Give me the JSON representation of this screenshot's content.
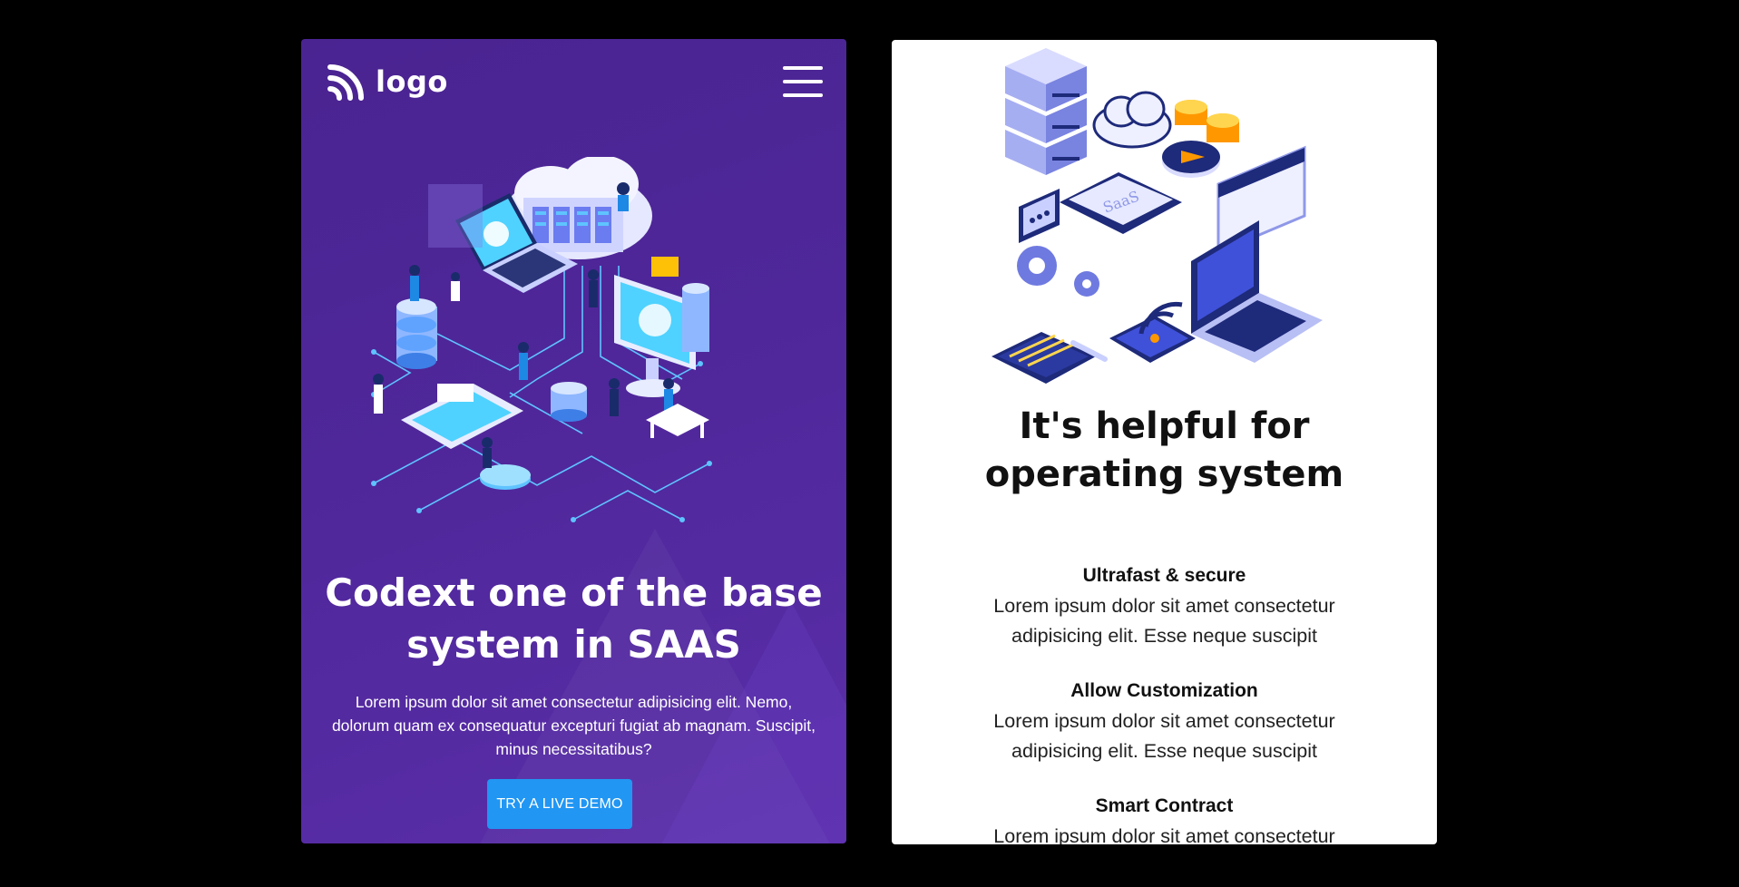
{
  "hero": {
    "logo_text": "logo",
    "title": "Codext one of the base system in SAAS",
    "text": "Lorem ipsum dolor sit amet consectetur adipisicing elit. Nemo, dolorum quam ex consequatur excepturi fugiat ab magnam. Suscipit, minus necessitatibus?",
    "button_label": "TRY A LIVE DEMO",
    "colors": {
      "background": "#4f279a",
      "button": "#2196f3",
      "text": "#ffffff"
    },
    "icons": [
      "logo-mark-icon",
      "hamburger-menu-icon"
    ]
  },
  "features": {
    "title": "It's helpful for operating system",
    "illustration_label": "SaaS",
    "items": [
      {
        "title": "Ultrafast & secure",
        "text": "Lorem ipsum dolor sit amet consectetur adipisicing elit. Esse neque suscipit"
      },
      {
        "title": "Allow Customization",
        "text": "Lorem ipsum dolor sit amet consectetur adipisicing elit. Esse neque suscipit"
      },
      {
        "title": "Smart Contract",
        "text": "Lorem ipsum dolor sit amet consectetur adipisicing elit. Esse neque suscipit"
      }
    ]
  }
}
